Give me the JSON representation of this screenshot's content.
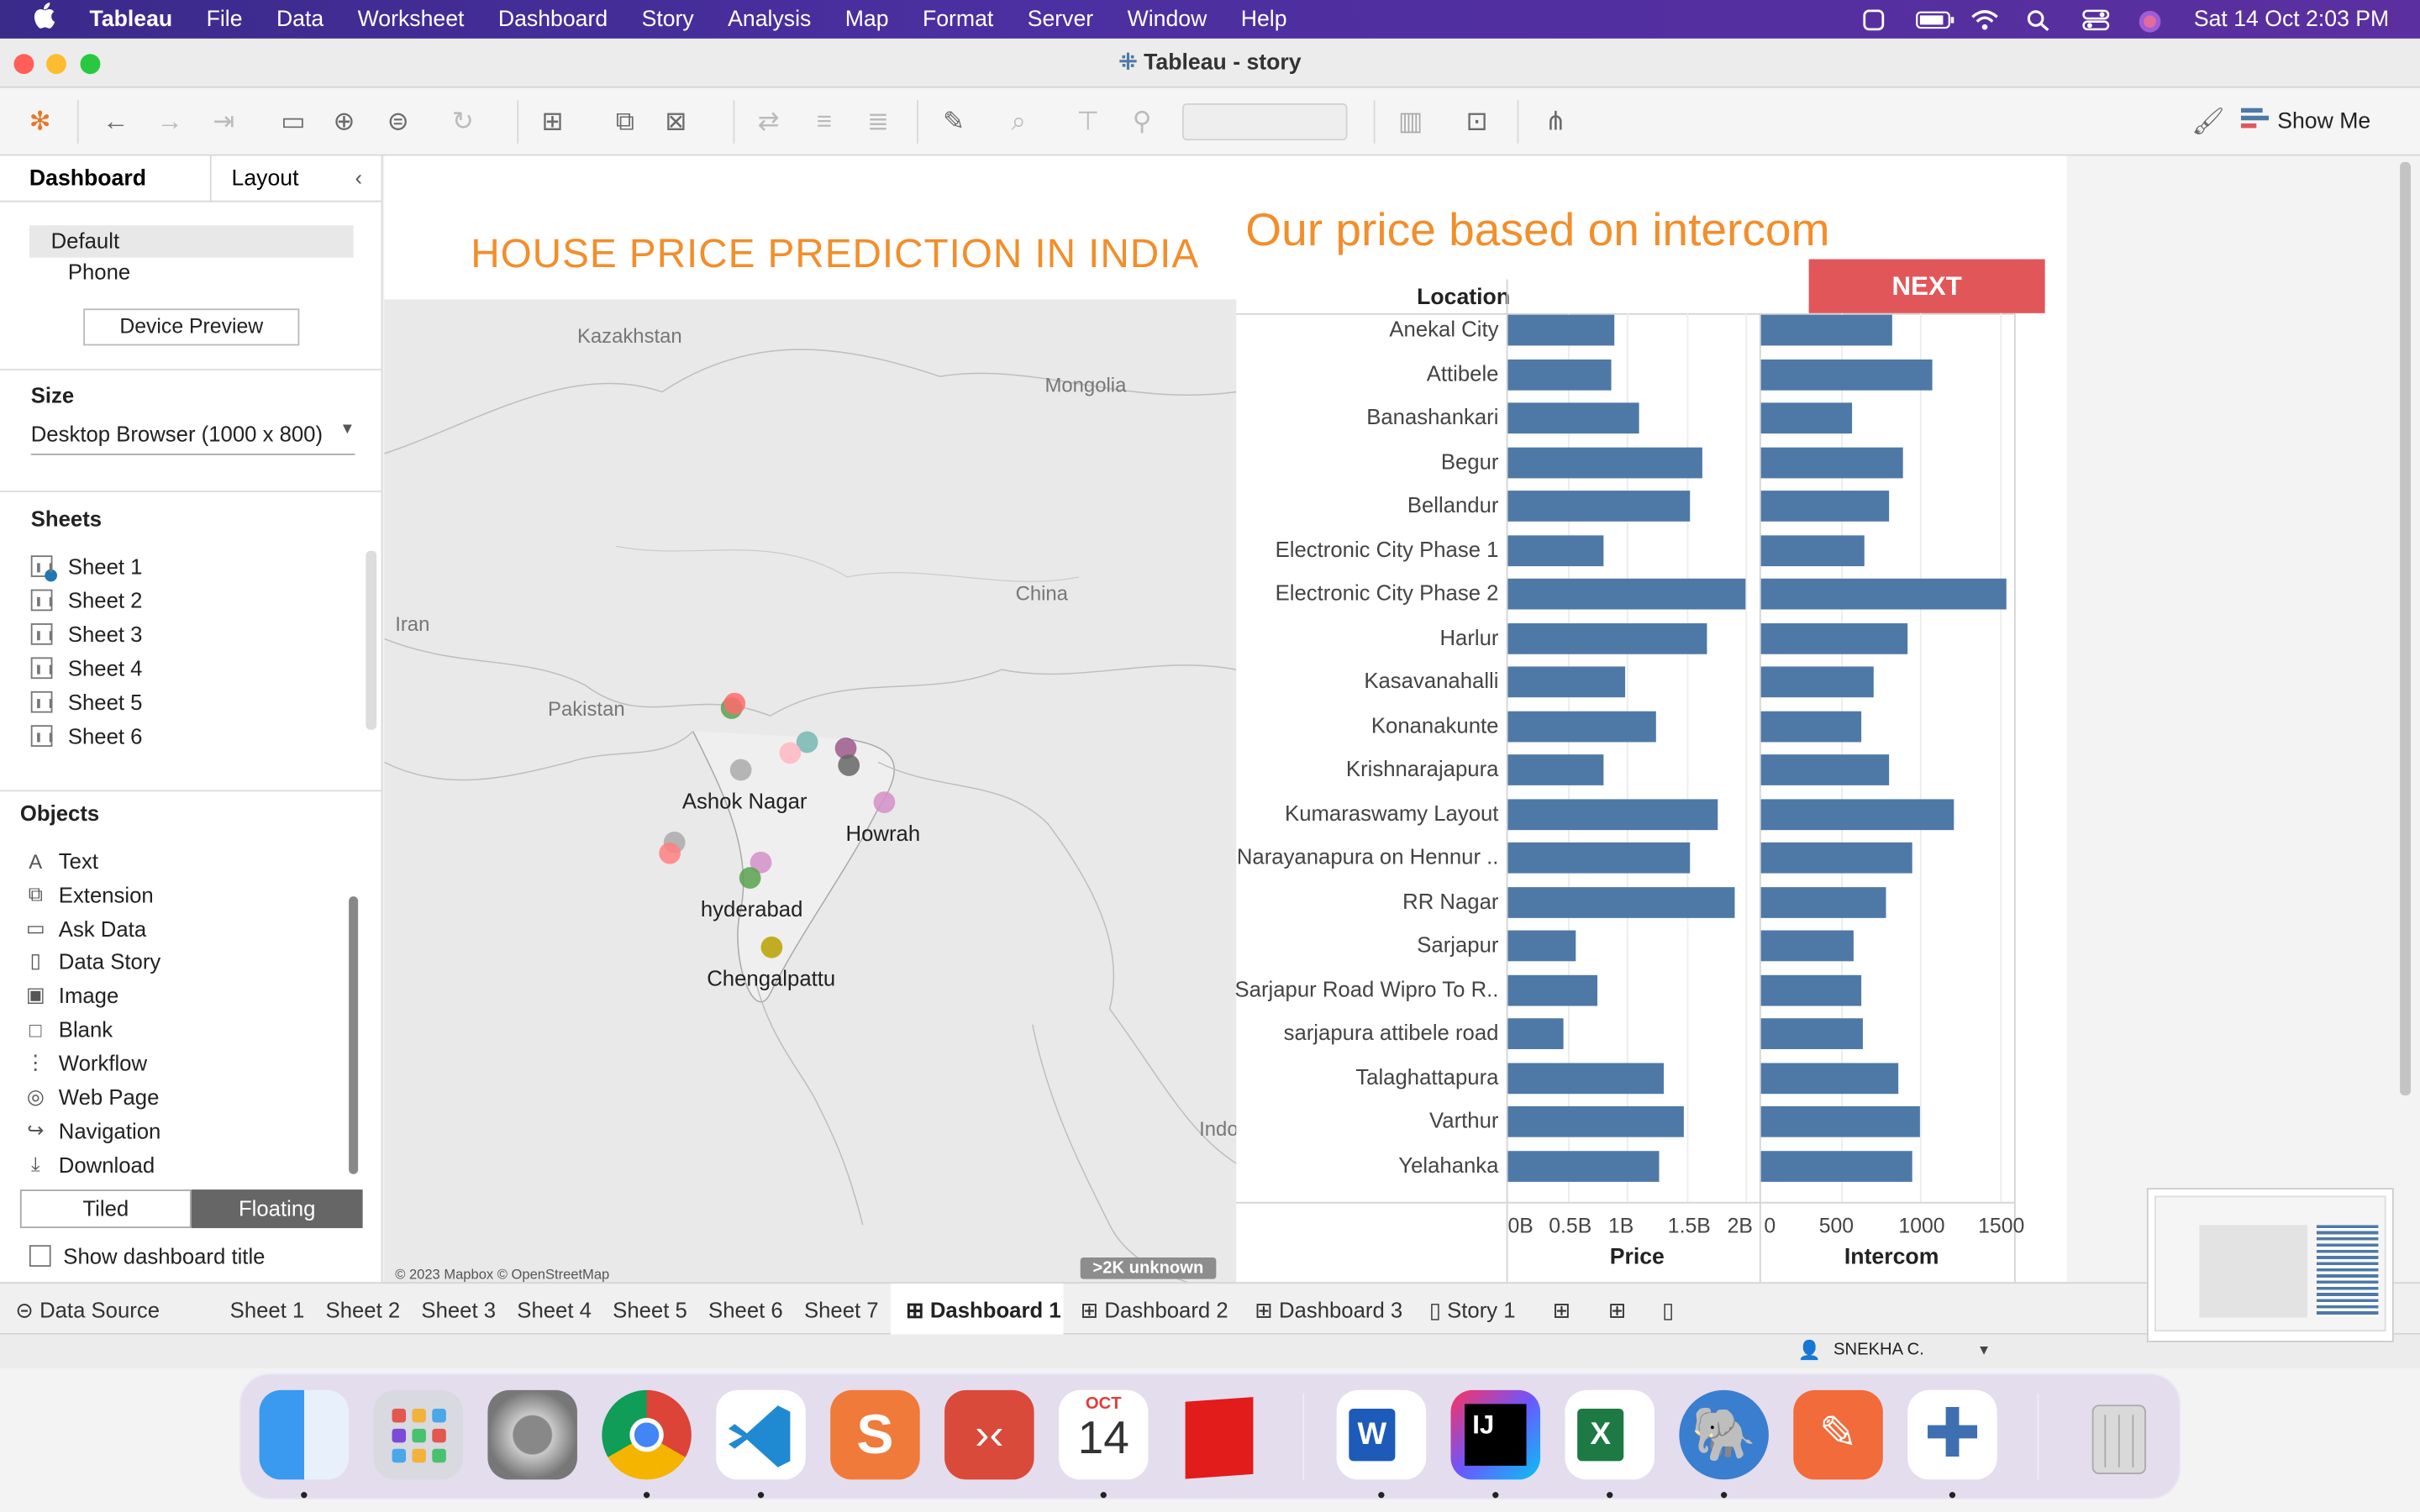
{
  "menubar": {
    "app": "Tableau",
    "items": [
      "File",
      "Data",
      "Worksheet",
      "Dashboard",
      "Story",
      "Analysis",
      "Map",
      "Format",
      "Server",
      "Window",
      "Help"
    ],
    "clock": "Sat 14 Oct  2:03 PM"
  },
  "window": {
    "title": "Tableau - story"
  },
  "toolbar": {
    "show_me": "Show Me"
  },
  "left_panel": {
    "tab_dashboard": "Dashboard",
    "tab_layout": "Layout",
    "device_default": "Default",
    "device_phone": "Phone",
    "device_preview": "Device Preview",
    "size_heading": "Size",
    "size_value": "Desktop Browser (1000 x 800)",
    "sheets_heading": "Sheets",
    "sheets": [
      "Sheet 1",
      "Sheet 2",
      "Sheet 3",
      "Sheet 4",
      "Sheet 5",
      "Sheet 6"
    ],
    "objects_heading": "Objects",
    "objects": [
      "Text",
      "Extension",
      "Ask Data",
      "Data Story",
      "Image",
      "Blank",
      "Workflow",
      "Web Page",
      "Navigation",
      "Download"
    ],
    "tiled": "Tiled",
    "floating": "Floating",
    "show_title": "Show dashboard title"
  },
  "dashboard": {
    "map_title": "HOUSE PRICE PREDICTION IN INDIA",
    "bar_title": "Our price based on intercom",
    "next_button": "NEXT",
    "location_header": "Location",
    "map_labels": {
      "kazakhstan": "Kazakhstan",
      "mongolia": "Mongolia",
      "iran": "Iran",
      "china": "China",
      "pakistan": "Pakistan",
      "indo": "Indo"
    },
    "city_labels": {
      "ashok": "Ashok Nagar",
      "howrah": "Howrah",
      "hyderabad": "hyderabad",
      "chengalpattu": "Chengalpattu"
    },
    "attribution": "© 2023 Mapbox © OpenStreetMap",
    "unknown": ">2K unknown",
    "price_ticks": [
      "0B",
      "0.5B",
      "1B",
      "1.5B",
      "2B"
    ],
    "intercom_ticks": [
      "0",
      "500",
      "1000",
      "1500"
    ],
    "price_axis": "Price",
    "intercom_axis": "Intercom"
  },
  "chart_data": {
    "type": "bar",
    "categories": [
      "Anekal City",
      "Attibele",
      "Banashankari",
      "Begur",
      "Bellandur",
      "Electronic City Phase 1",
      "Electronic City Phase 2",
      "Harlur",
      "Kasavanahalli",
      "Konanakunte",
      "Krishnarajapura",
      "Kumaraswamy Layout",
      "Narayanapura on Hennur ..",
      "RR Nagar",
      "Sarjapur",
      "Sarjapur Road Wipro To R..",
      "sarjapura attibele road",
      "Talaghattapura",
      "Varthur",
      "Yelahanka"
    ],
    "series": [
      {
        "name": "Price",
        "values": [
          0.89,
          0.87,
          1.1,
          1.63,
          1.53,
          0.81,
          2.0,
          1.68,
          0.99,
          1.25,
          0.81,
          1.77,
          1.53,
          1.91,
          0.57,
          0.75,
          0.47,
          1.31,
          1.48,
          1.27
        ],
        "xlim": [
          0,
          2.05
        ],
        "unit": "B"
      },
      {
        "name": "Intercom",
        "values": [
          820,
          1080,
          570,
          890,
          800,
          650,
          1540,
          920,
          710,
          630,
          800,
          1210,
          950,
          790,
          580,
          630,
          640,
          860,
          1000,
          950
        ],
        "xlim": [
          0,
          1600
        ]
      }
    ]
  },
  "bottom_tabs": [
    "Data Source",
    "Sheet 1",
    "Sheet 2",
    "Sheet 3",
    "Sheet 4",
    "Sheet 5",
    "Sheet 6",
    "Sheet 7",
    "Dashboard 1",
    "Dashboard 2",
    "Dashboard 3",
    "Story 1"
  ],
  "status": {
    "user": "SNEKHA C."
  },
  "dock": {
    "calendar_month": "OCT",
    "calendar_day": "14"
  }
}
